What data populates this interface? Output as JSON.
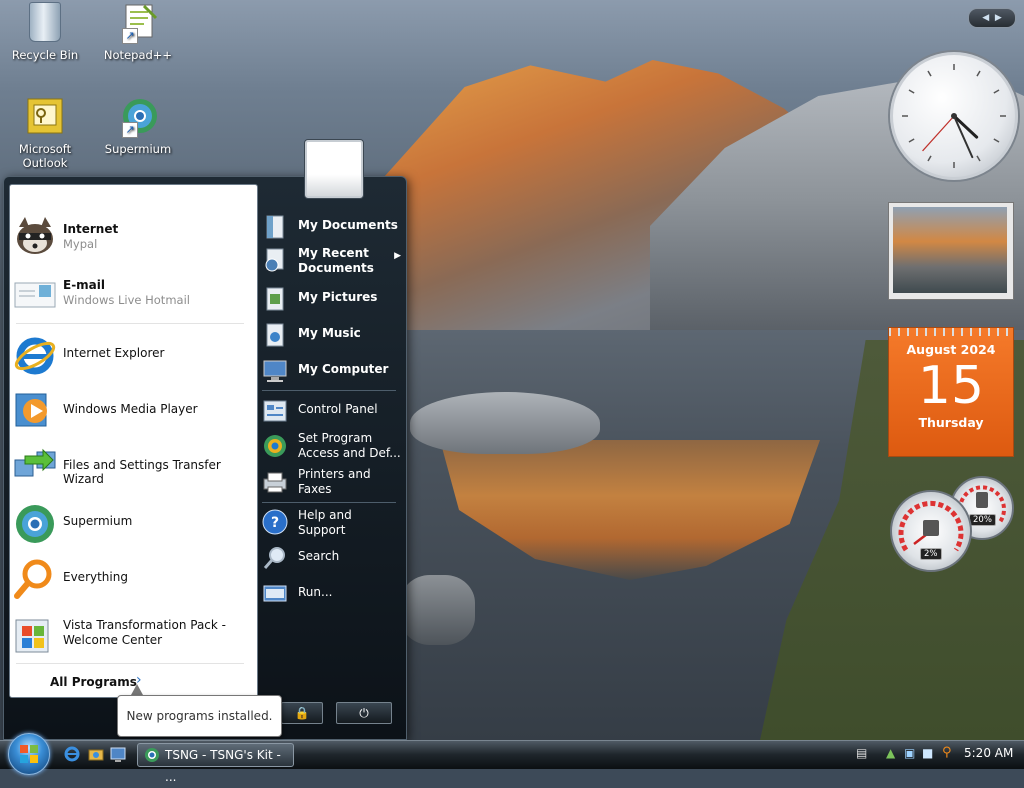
{
  "desktop": {
    "icons": [
      {
        "label": "Recycle Bin"
      },
      {
        "label": "Notepad++"
      },
      {
        "label": "Microsoft\nOutlook"
      },
      {
        "label": "Supermium"
      }
    ]
  },
  "start_menu": {
    "pinned": [
      {
        "title": "Internet",
        "subtitle": "Mypal",
        "icon": "raccoon-browser-icon"
      },
      {
        "title": "E-mail",
        "subtitle": "Windows Live Hotmail",
        "icon": "email-icon"
      }
    ],
    "recent": [
      {
        "title": "Internet Explorer",
        "icon": "internet-explorer-icon"
      },
      {
        "title": "Windows Media Player",
        "icon": "media-player-icon"
      },
      {
        "title": "Files and Settings Transfer Wizard",
        "icon": "transfer-wizard-icon"
      },
      {
        "title": "Supermium",
        "icon": "supermium-icon"
      },
      {
        "title": "Everything",
        "icon": "search-magnifier-icon"
      },
      {
        "title": "Vista Transformation Pack -\nWelcome Center",
        "icon": "welcome-center-icon"
      }
    ],
    "all_programs": "All Programs",
    "right": [
      {
        "label": "My Documents",
        "icon": "documents-icon"
      },
      {
        "label": "My Recent\nDocuments",
        "icon": "recent-documents-icon",
        "submenu": true
      },
      {
        "label": "My Pictures",
        "icon": "pictures-icon"
      },
      {
        "label": "My Music",
        "icon": "music-icon"
      },
      {
        "label": "My Computer",
        "icon": "computer-icon"
      },
      {
        "label": "Control Panel",
        "icon": "control-panel-icon"
      },
      {
        "label": "Set Program\nAccess and Def...",
        "icon": "program-access-icon"
      },
      {
        "label": "Printers and\nFaxes",
        "icon": "printer-icon"
      },
      {
        "label": "Help and\nSupport",
        "icon": "help-icon"
      },
      {
        "label": "Search",
        "icon": "search-icon"
      },
      {
        "label": "Run...",
        "icon": "run-icon"
      }
    ],
    "tooltip": "New programs installed."
  },
  "gadgets": {
    "calendar": {
      "month": "August 2024",
      "day": "15",
      "weekday": "Thursday"
    },
    "cpu_percent": "2%",
    "memory_percent": "20%",
    "clock_time": {
      "hour": 4,
      "minute": 26,
      "second": 37
    }
  },
  "taskbar": {
    "task_label": "TSNG - TSNG's Kit - ...",
    "time": "5:20 AM"
  },
  "colors": {
    "calendar_orange": "#ee6a1c",
    "start_menu_dark": "#0c1218",
    "link_blue": "#2b72c4"
  }
}
